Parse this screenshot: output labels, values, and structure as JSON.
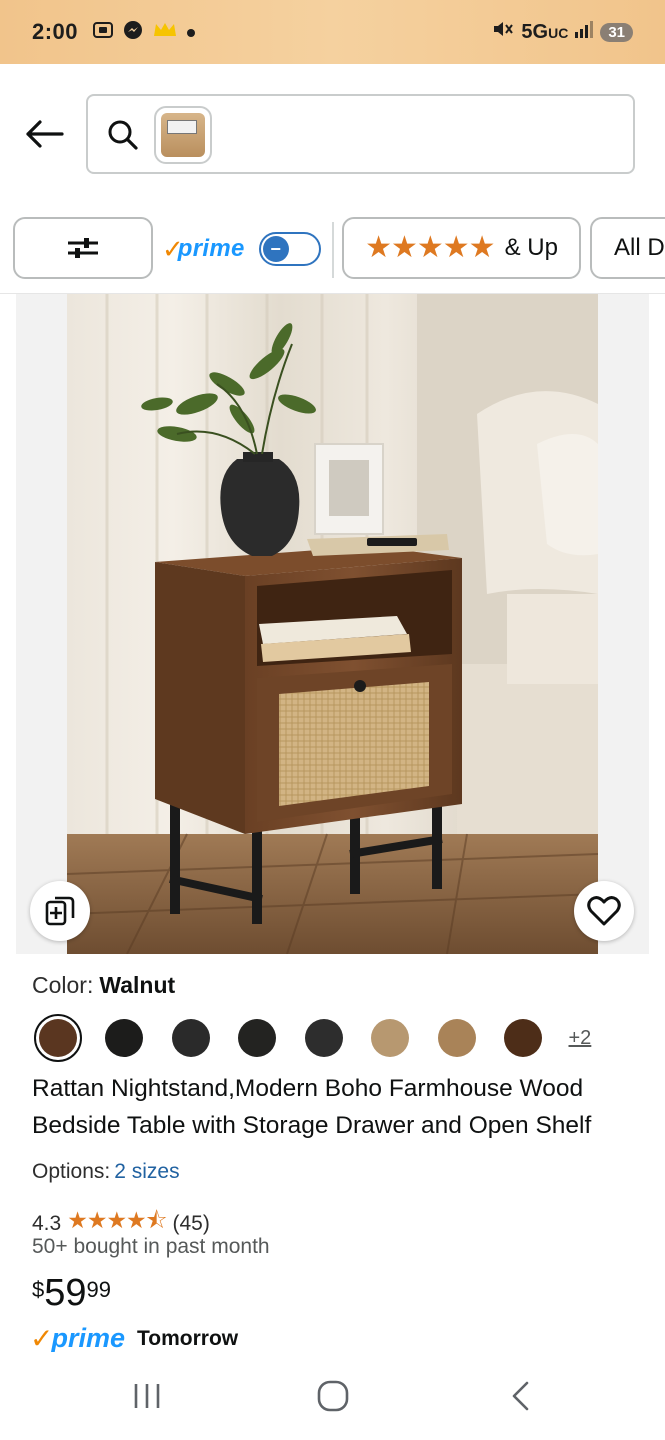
{
  "status_bar": {
    "time": "2:00",
    "network": "5G",
    "network_sub": "UC",
    "battery": "31",
    "mute_icon": "mute-icon"
  },
  "search": {
    "placeholder": "",
    "back_icon": "arrow-left-icon",
    "search_icon": "magnifier-icon"
  },
  "filters": {
    "filter_icon": "sliders-icon",
    "prime_label": "prime",
    "prime_check": "✓",
    "toggle_symbol": "−",
    "stars_label": "★★★★★",
    "up_label": "& Up",
    "all_label": "All D"
  },
  "product": {
    "color_label": "Color:",
    "color_value": "Walnut",
    "swatches": [
      "#5a3620",
      "#1c1c1b",
      "#2a2a2a",
      "#232321",
      "#2d2d2d",
      "#b79870",
      "#a98358",
      "#4d2d18"
    ],
    "more_colors": "+2",
    "title": "Rattan Nightstand,Modern Boho Farmhouse Wood Bedside Table with Storage Drawer and Open Shelf",
    "options_label": "Options:",
    "options_value": "2 sizes",
    "rating_value": "4.3",
    "rating_stars": "★★★★⯪",
    "rating_count": "(45)",
    "bought": "50+ bought in past month",
    "price_symbol": "$",
    "price_whole": "59",
    "price_fraction": "99",
    "delivery_check": "✓",
    "delivery_prime": "prime",
    "delivery_text": "Tomorrow"
  },
  "navbar": {
    "recents_icon": "recents-icon",
    "home_icon": "home-icon",
    "back_icon": "back-chevron-icon"
  }
}
